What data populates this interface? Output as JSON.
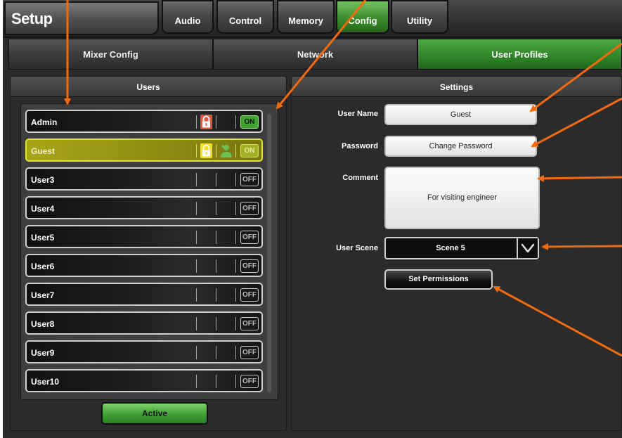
{
  "header": {
    "setup_label": "Setup",
    "tabs": [
      {
        "label": "Audio",
        "active": false
      },
      {
        "label": "Control",
        "active": false
      },
      {
        "label": "Memory",
        "active": false
      },
      {
        "label": "Config",
        "active": true
      },
      {
        "label": "Utility",
        "active": false
      }
    ]
  },
  "subtabs": [
    {
      "label": "Mixer Config",
      "active": false
    },
    {
      "label": "Network",
      "active": false
    },
    {
      "label": "User Profiles",
      "active": true
    }
  ],
  "users_panel": {
    "title": "Users",
    "users": [
      {
        "name": "Admin",
        "status": "ON",
        "locked": true,
        "selected": false,
        "has_user_icon": false
      },
      {
        "name": "Guest",
        "status": "ON",
        "locked": true,
        "selected": true,
        "has_user_icon": true
      },
      {
        "name": "User3",
        "status": "OFF",
        "locked": false,
        "selected": false,
        "has_user_icon": false
      },
      {
        "name": "User4",
        "status": "OFF",
        "locked": false,
        "selected": false,
        "has_user_icon": false
      },
      {
        "name": "User5",
        "status": "OFF",
        "locked": false,
        "selected": false,
        "has_user_icon": false
      },
      {
        "name": "User6",
        "status": "OFF",
        "locked": false,
        "selected": false,
        "has_user_icon": false
      },
      {
        "name": "User7",
        "status": "OFF",
        "locked": false,
        "selected": false,
        "has_user_icon": false
      },
      {
        "name": "User8",
        "status": "OFF",
        "locked": false,
        "selected": false,
        "has_user_icon": false
      },
      {
        "name": "User9",
        "status": "OFF",
        "locked": false,
        "selected": false,
        "has_user_icon": false
      },
      {
        "name": "User10",
        "status": "OFF",
        "locked": false,
        "selected": false,
        "has_user_icon": false
      }
    ],
    "active_button": "Active"
  },
  "settings_panel": {
    "title": "Settings",
    "user_name_label": "User Name",
    "user_name_value": "Guest",
    "password_label": "Password",
    "password_button": "Change Password",
    "comment_label": "Comment",
    "comment_value": "For visiting engineer",
    "user_scene_label": "User Scene",
    "user_scene_value": "Scene 5",
    "set_permissions_button": "Set Permissions"
  },
  "colors": {
    "accent_green": "#3c8c2e",
    "selected_yellow": "#a7a617",
    "annotation_orange": "#f26a10"
  }
}
